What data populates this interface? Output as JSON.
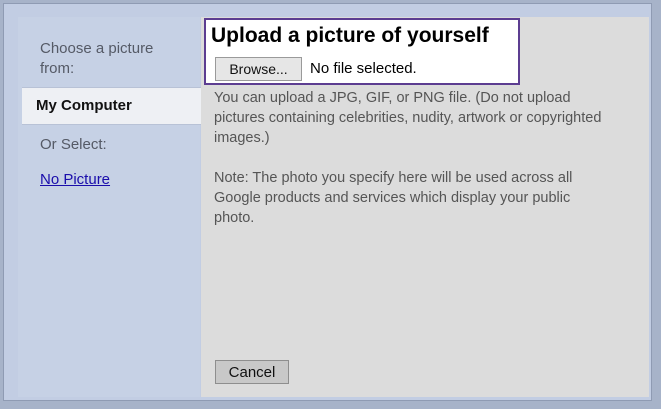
{
  "sidebar": {
    "choose_label": "Choose a picture from:",
    "my_computer": "My Computer",
    "or_select": "Or Select:",
    "no_picture": "No Picture"
  },
  "upload": {
    "title": "Upload a picture of yourself",
    "browse_label": "Browse...",
    "file_status": "No file selected."
  },
  "content": {
    "info": "You can upload a JPG, GIF, or PNG file. (Do not upload pictures containing celebrities, nudity, artwork or copyrighted images.)",
    "note": "Note: The photo you specify here will be used across all Google products and services which display your public photo."
  },
  "footer": {
    "cancel_label": "Cancel"
  },
  "colors": {
    "dialog_bg": "#c2cde3",
    "content_bg": "#dcdcdc",
    "upload_border": "#5c3d91",
    "link": "#1a0dab"
  }
}
